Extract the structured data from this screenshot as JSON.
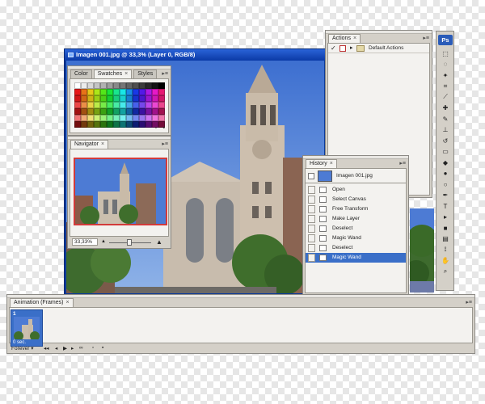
{
  "document": {
    "title": "Imagen 001.jpg @ 33,3% (Layer 0, RGB/8)"
  },
  "swatches_panel": {
    "tabs": [
      "Color",
      "Swatches",
      "Styles"
    ],
    "active_tab": "Swatches"
  },
  "navigator": {
    "tab": "Navigator",
    "zoom": "33,33%"
  },
  "actions": {
    "tab": "Actions",
    "item": "Default Actions"
  },
  "history": {
    "tab": "History",
    "snapshot": "Imagen 001.jpg",
    "steps": [
      "Open",
      "Select Canvas",
      "Free Transform",
      "Make Layer",
      "Deselect",
      "Magic Wand",
      "Deselect",
      "Magic Wand"
    ],
    "selected_index": 7
  },
  "animation": {
    "tab": "Animation (Frames)",
    "frame_number": "1",
    "frame_delay": "0 sec.",
    "loop": "Forever"
  },
  "toolbox": {
    "logo": "Ps",
    "tools": [
      "marquee-icon",
      "lasso-icon",
      "magic-wand-icon",
      "crop-icon",
      "slice-icon",
      "healing-icon",
      "brush-icon",
      "stamp-icon",
      "history-brush-icon",
      "eraser-icon",
      "bucket-icon",
      "blur-icon",
      "dodge-icon",
      "pen-icon",
      "type-icon",
      "path-select-icon",
      "shape-icon",
      "notes-icon",
      "eyedropper-icon",
      "hand-icon",
      "zoom-icon"
    ]
  },
  "colors": {
    "panel": "#d4d0c8",
    "title_bar": "#0b3aa6",
    "selection": "#3a6fc8",
    "sky": "#5a86d6"
  }
}
